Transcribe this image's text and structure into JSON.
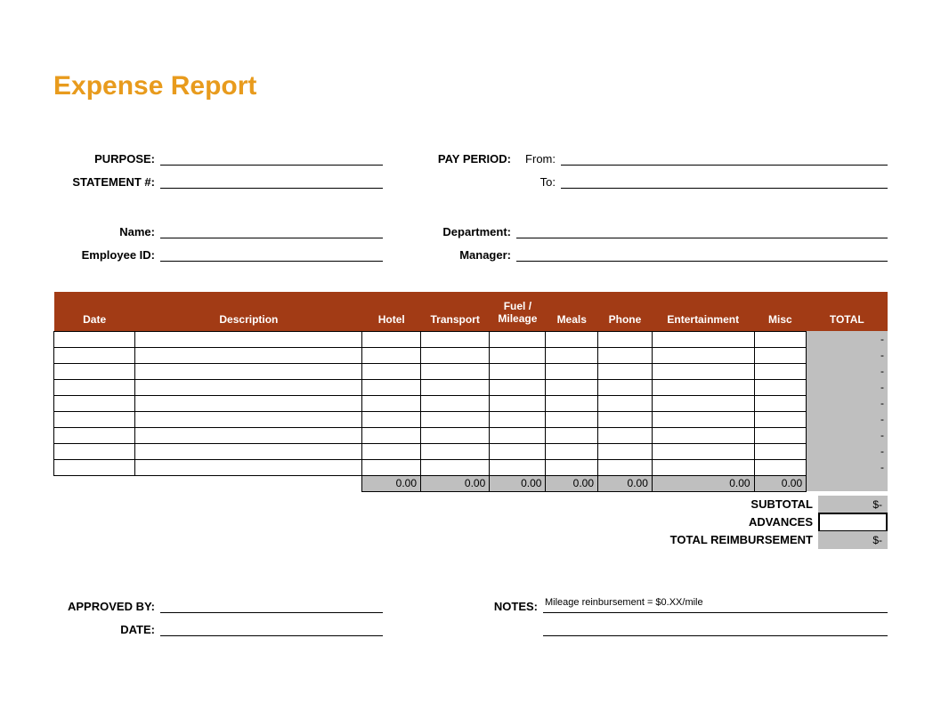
{
  "title": "Expense Report",
  "header": {
    "purpose_label": "PURPOSE:",
    "statement_label": "STATEMENT #:",
    "pay_period_label": "PAY PERIOD:",
    "from_label": "From:",
    "to_label": "To:",
    "name_label": "Name:",
    "employee_id_label": "Employee ID:",
    "department_label": "Department:",
    "manager_label": "Manager:"
  },
  "table": {
    "headers": {
      "date": "Date",
      "description": "Description",
      "hotel": "Hotel",
      "transport": "Transport",
      "fuel": "Fuel / Mileage",
      "meals": "Meals",
      "phone": "Phone",
      "entertainment": "Entertainment",
      "misc": "Misc",
      "total": "TOTAL"
    },
    "row_total_placeholder": "-",
    "col_totals": {
      "hotel": "0.00",
      "transport": "0.00",
      "fuel": "0.00",
      "meals": "0.00",
      "phone": "0.00",
      "entertainment": "0.00",
      "misc": "0.00"
    }
  },
  "summary": {
    "subtotal_label": "SUBTOTAL",
    "subtotal_value": "$-",
    "advances_label": "ADVANCES",
    "advances_value": "",
    "reimbursement_label": "TOTAL REIMBURSEMENT",
    "reimbursement_value": "$-"
  },
  "footer": {
    "approved_label": "APPROVED BY:",
    "date_label": "DATE:",
    "notes_label": "NOTES:",
    "notes_value": "Mileage reinbursement = $0.XX/mile"
  }
}
